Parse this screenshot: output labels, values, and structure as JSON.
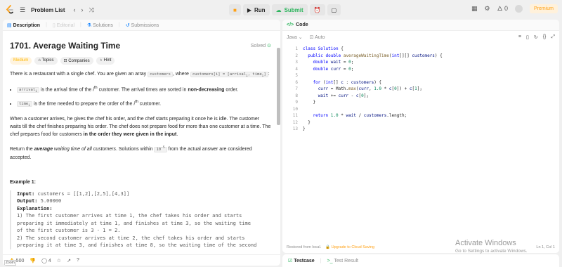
{
  "topbar": {
    "problem_list": "Problem List",
    "run": "Run",
    "submit": "Submit",
    "streak": "0",
    "premium": "Premium"
  },
  "left_tabs": [
    "Description",
    "Editorial",
    "Solutions",
    "Submissions"
  ],
  "problem": {
    "title": "1701. Average Waiting Time",
    "solved": "Solved",
    "chips": [
      "Medium",
      "Topics",
      "Companies",
      "Hint"
    ],
    "p1_a": "There is a restaurant with a single chef. You are given an array ",
    "p1_code1": "customers",
    "p1_b": ", where ",
    "p1_code2": "customers[i] = [arrival",
    "p1_code2_sub": "i",
    "p1_code3": ", time",
    "p1_code3_sub": "i",
    "p1_code4": "]",
    "p1_c": ":",
    "b1_code": "arrival",
    "b1_sub": "i",
    "b1_a": " is the arrival time of the ",
    "b1_sup": "th",
    "b1_b": " customer. The arrival times are sorted in ",
    "b1_bold": "non-decreasing",
    "b1_c": " order.",
    "b2_code": "time",
    "b2_sub": "i",
    "b2_a": " is the time needed to prepare the order of the ",
    "b2_sup": "th",
    "b2_b": " customer.",
    "p2": "When a customer arrives, he gives the chef his order, and the chef starts preparing it once he is idle. The customer waits till the chef finishes preparing his order. The chef does not prepare food for more than one customer at a time. The chef prepares food for customers ",
    "p2_bold": "in the order they were given in the input",
    "p2_end": ".",
    "p3_a": "Return the ",
    "p3_bi": "average",
    "p3_i": " waiting time of all customers",
    "p3_b": ". Solutions within ",
    "p3_exp": "10",
    "p3_exp_sup": "-5",
    "p3_c": " from the actual answer are considered accepted.",
    "example_title": "Example 1:",
    "ex_input_label": "Input:",
    "ex_input": " customers = [[1,2],[2,5],[4,3]]",
    "ex_output_label": "Output:",
    "ex_output": " 5.00000",
    "ex_expl_label": "Explanation:",
    "ex_lines": [
      "1) The first customer arrives at time 1, the chef takes his order and starts",
      "preparing it immediately at time 1, and finishes at time 3, so the waiting time",
      "of the first customer is 3 - 1 = 2.",
      "2) The second customer arrives at time 2, the chef takes his order and starts",
      "preparing it at time 3, and finishes at time 8, so the waiting time of the second"
    ]
  },
  "left_footer": {
    "likes": "500",
    "comments": "4"
  },
  "code": {
    "header": "Code",
    "language": "Java",
    "auto": "Auto",
    "line_numbers": [
      "1",
      "2",
      "3",
      "4",
      "5",
      "6",
      "7",
      "8",
      "9",
      "10",
      "11",
      "12",
      "13"
    ],
    "footer_saved": "Restored from local.",
    "footer_upgrade": "Upgrade to Cloud Saving",
    "footer_pos": "Ln 1, Col 1"
  },
  "bottom_tabs": {
    "testcase": "Testcase",
    "result": "Test Result"
  },
  "windows": {
    "line1": "Activate Windows",
    "line2": "Go to Settings to activate Windows."
  },
  "zoom_badge": "Zoom",
  "colors": {
    "accent_green": "#2db55d",
    "premium_orange": "#ffa116",
    "medium_yellow": "#ffb800"
  }
}
